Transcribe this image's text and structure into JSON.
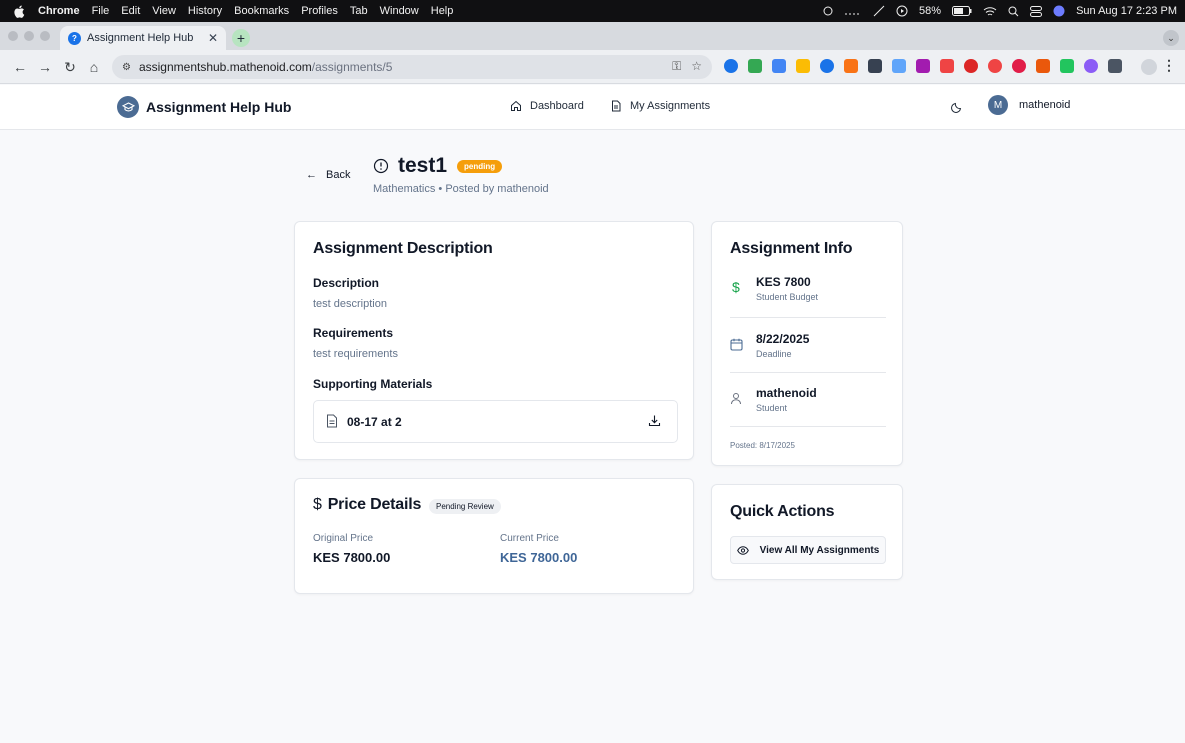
{
  "os_menubar": {
    "app": "Chrome",
    "menus": [
      "File",
      "Edit",
      "View",
      "History",
      "Bookmarks",
      "Profiles",
      "Tab",
      "Window",
      "Help"
    ],
    "battery": "58%",
    "datetime": "Sun Aug 17  2:23 PM"
  },
  "browser": {
    "tab_title": "Assignment Help Hub",
    "url_host": "assignmentshub.mathenoid.com",
    "url_path": "/assignments/5"
  },
  "header": {
    "brand": "Assignment Help Hub",
    "nav": {
      "dashboard": "Dashboard",
      "my_assignments": "My Assignments"
    },
    "user_initial": "M",
    "username": "mathenoid"
  },
  "page": {
    "back_label": "Back",
    "title": "test1",
    "status": "pending",
    "subtitle": "Mathematics • Posted by mathenoid"
  },
  "description_card": {
    "heading": "Assignment Description",
    "description_label": "Description",
    "description": "test description",
    "requirements_label": "Requirements",
    "requirements": "test requirements",
    "materials_label": "Supporting Materials",
    "file_name": "08-17 at 2"
  },
  "price_card": {
    "heading": "Price Details",
    "badge": "Pending Review",
    "original_label": "Original Price",
    "original_value": "KES 7800.00",
    "current_label": "Current Price",
    "current_value": "KES 7800.00"
  },
  "info_card": {
    "heading": "Assignment Info",
    "budget": "KES 7800",
    "budget_label": "Student Budget",
    "deadline": "8/22/2025",
    "deadline_label": "Deadline",
    "student": "mathenoid",
    "student_label": "Student",
    "posted": "Posted: 8/17/2025"
  },
  "quick_actions": {
    "heading": "Quick Actions",
    "view_all": "View All My Assignments"
  },
  "colors": {
    "accent": "#4b6b93",
    "pending": "#f59e0b",
    "money_green": "#16a34a",
    "price_blue": "#3f6697"
  }
}
